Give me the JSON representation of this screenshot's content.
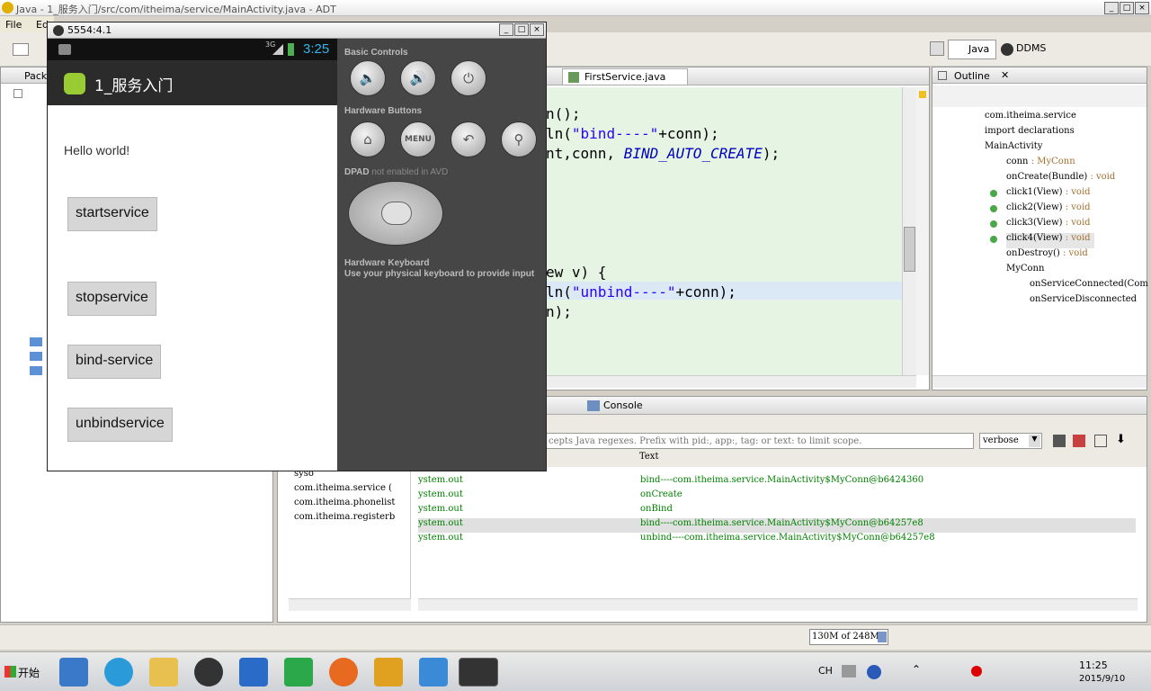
{
  "window": {
    "title": "Java - 1_服务入门/src/com/itheima/service/MainActivity.java - ADT"
  },
  "menu": {
    "file": "File",
    "edit": "Ed"
  },
  "perspectives": {
    "java": "Java",
    "ddms": "DDMS"
  },
  "package_explorer": {
    "title": "Pack"
  },
  "editor": {
    "tab": "FirstService.java",
    "lines": [
      {
        "pre": "n();",
        "s": "",
        "post": "",
        "k": ""
      },
      {
        "pre": "ln(",
        "s": "\"bind----\"",
        "post": "+conn);",
        "k": ""
      },
      {
        "pre": "nt,conn, ",
        "s": "",
        "post": ");",
        "k": "BIND_AUTO_CREATE"
      },
      {
        "pre": "ew v) {",
        "s": "",
        "post": "",
        "k": ""
      },
      {
        "pre": "ln(",
        "s": "\"unbind----\"",
        "post": "+conn);",
        "k": ""
      },
      {
        "pre": "n);",
        "s": "",
        "post": "",
        "k": ""
      }
    ]
  },
  "outline": {
    "title": "Outline",
    "items": [
      {
        "label": "com.itheima.service",
        "type": ""
      },
      {
        "label": "import declarations",
        "type": ""
      },
      {
        "label": "MainActivity",
        "type": ""
      },
      {
        "label": "conn",
        "type": " : MyConn"
      },
      {
        "label": "onCreate(Bundle)",
        "type": " : void"
      },
      {
        "label": "click1(View)",
        "type": " : void"
      },
      {
        "label": "click2(View)",
        "type": " : void"
      },
      {
        "label": "click3(View)",
        "type": " : void"
      },
      {
        "label": "click4(View)",
        "type": " : void"
      },
      {
        "label": "onDestroy()",
        "type": " : void"
      },
      {
        "label": "MyConn",
        "type": ""
      },
      {
        "label": "onServiceConnected(Com",
        "type": ""
      },
      {
        "label": "onServiceDisconnected",
        "type": ""
      }
    ]
  },
  "logcat": {
    "console_tab": "Console",
    "filter_placeholder": "cepts Java regexes. Prefix with pid:, app:, tag: or text: to limit scope.",
    "level": "verbose",
    "col_text": "Text",
    "filters": [
      "syso",
      "com.itheima.service (",
      "com.itheima.phonelist",
      "com.itheima.registerb"
    ],
    "rows": [
      {
        "tag": "ystem.out",
        "text": "bind----com.itheima.service.MainActivity$MyConn@b6424360"
      },
      {
        "tag": "ystem.out",
        "text": "onCreate"
      },
      {
        "tag": "ystem.out",
        "text": "onBind"
      },
      {
        "tag": "ystem.out",
        "text": "bind----com.itheima.service.MainActivity$MyConn@b64257e8"
      },
      {
        "tag": "ystem.out",
        "text": "unbind----com.itheima.service.MainActivity$MyConn@b64257e8"
      }
    ]
  },
  "status": {
    "memory": "130M of 248M"
  },
  "emulator": {
    "title": "5554:4.1",
    "network": "3G",
    "clock": "3:25",
    "app_title": "1_服务入门",
    "hello": "Hello world!",
    "buttons": [
      "startservice",
      "stopservice",
      "bind-service",
      "unbindservice"
    ],
    "basic_controls": "Basic Controls",
    "hardware_buttons": "Hardware Buttons",
    "dpad": "DPAD",
    "dpad_note": "not enabled in AVD",
    "keyboard_title": "Hardware Keyboard",
    "keyboard_note": "Use your physical keyboard to provide input",
    "menu_key": "MENU"
  },
  "taskbar": {
    "start": "开始",
    "ime": "CH",
    "time": "11:25",
    "date": "2015/9/10",
    "icons": [
      "desktop-icon",
      "browser-icon",
      "folder-icon",
      "qq-icon",
      "word-icon",
      "code-icon",
      "firefox-icon",
      "search-icon",
      "cloud-icon",
      "android-icon"
    ]
  }
}
